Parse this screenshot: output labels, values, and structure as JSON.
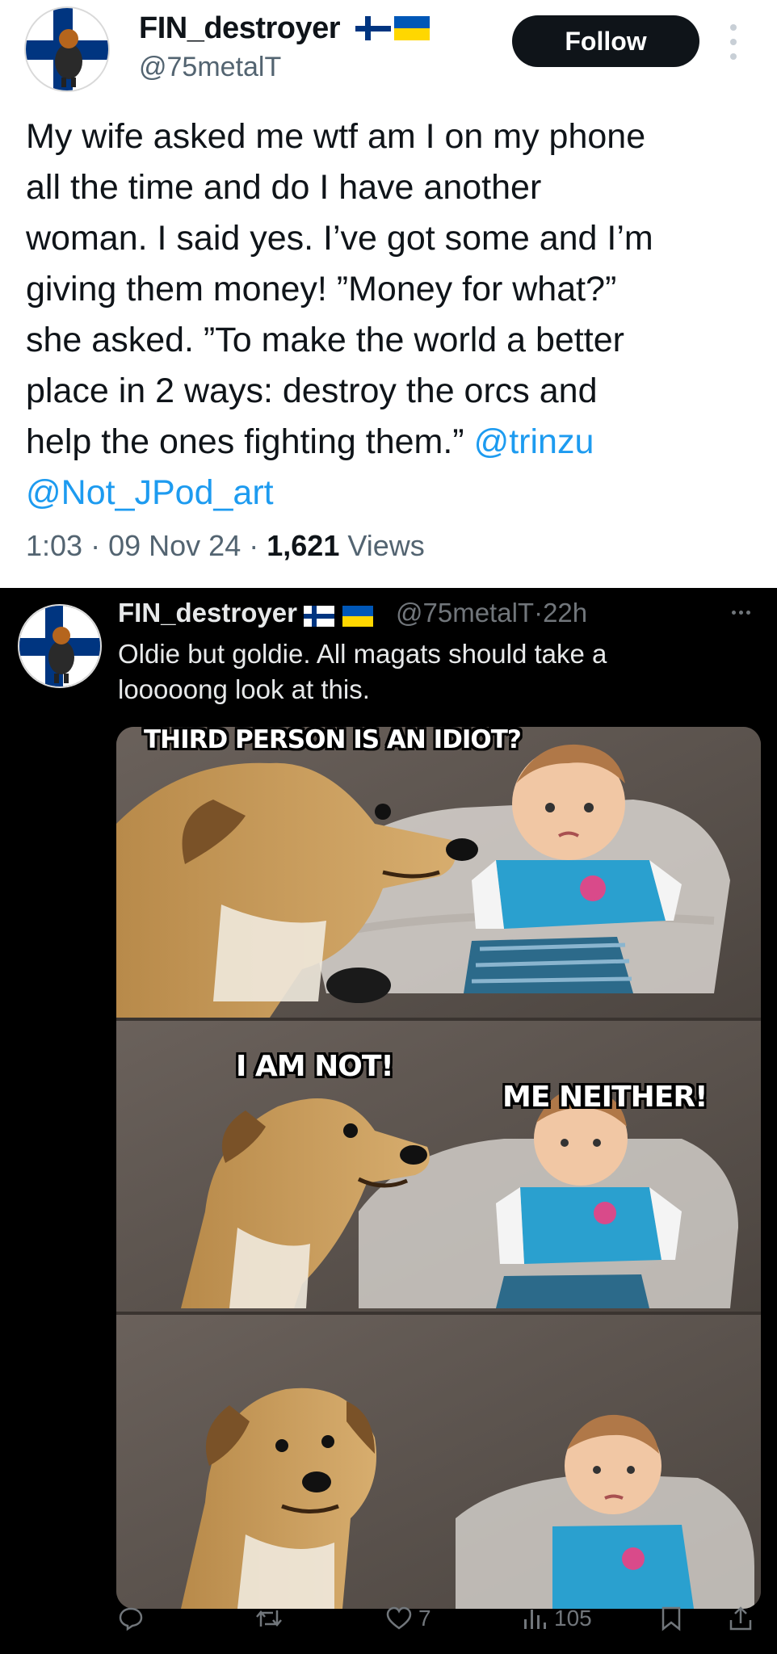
{
  "tweet": {
    "author": {
      "name": "FIN_destroyer",
      "handle": "@75metalT"
    },
    "follow_label": "Follow",
    "text_lines": [
      "My wife asked me wtf am I on my phone",
      "all the time and do I have another",
      "woman. I said yes. I’ve got some and I’m",
      "giving them money! ”Money for what?”",
      "she asked. ”To make the world a better",
      "place in 2 ways: destroy the orcs and",
      "help the ones fighting them.”"
    ],
    "mentions": [
      "@trinzu",
      "@Not_JPod_art"
    ],
    "time": "1:03",
    "date": "09 Nov 24",
    "views_count": "1,621",
    "views_label": "Views",
    "separator": "·"
  },
  "quoted": {
    "author": {
      "name": "FIN_destroyer",
      "handle": "@75metalT",
      "age": "22h"
    },
    "text_lines": [
      "Oldie but goldie. All magats should take a",
      "looooong look at this."
    ],
    "meme_captions": {
      "top": "THIRD PERSON IS AN IDIOT?",
      "dog": "I AM NOT!",
      "baby": "ME NEITHER!"
    },
    "actions": {
      "reply": {
        "icon": "reply-icon",
        "count": ""
      },
      "repost": {
        "icon": "repost-icon",
        "count": ""
      },
      "like": {
        "icon": "heart-icon",
        "count": "7"
      },
      "views": {
        "icon": "views-icon",
        "count": "105"
      },
      "bookmark": {
        "icon": "bookmark-icon"
      },
      "share": {
        "icon": "share-icon"
      }
    }
  },
  "colors": {
    "link": "#1d9bf0",
    "text_dark": "#0f1419",
    "muted": "#536471",
    "dark_bg": "#000000",
    "dark_text": "#e7e9ea",
    "dark_muted": "#71767b",
    "finland_blue": "#003580",
    "ukraine_blue": "#0057b7",
    "ukraine_yellow": "#ffd700"
  }
}
